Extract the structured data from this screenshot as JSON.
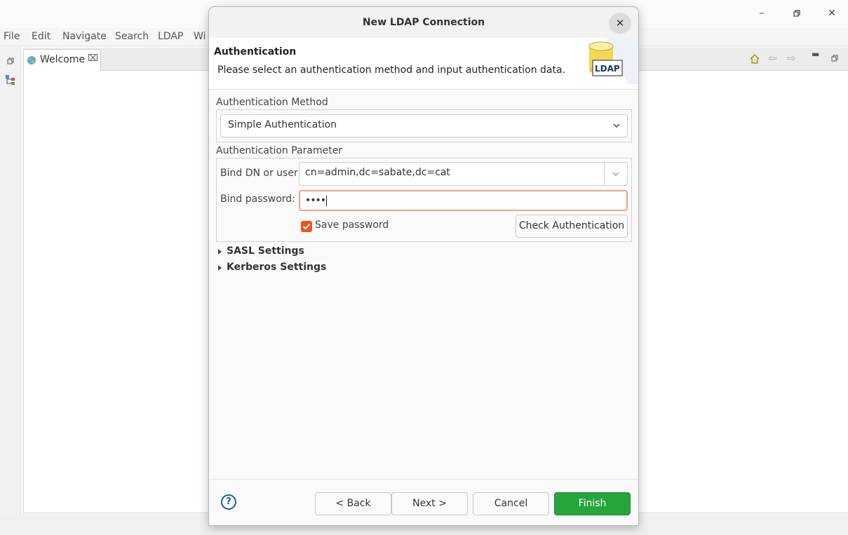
{
  "ide": {
    "menu": [
      "File",
      "Edit",
      "Navigate",
      "Search",
      "LDAP",
      "Wi"
    ],
    "tab_welcome": "Welcome",
    "window_controls": [
      "minimize-icon",
      "restore-icon",
      "close-icon"
    ]
  },
  "dialog": {
    "title": "New LDAP Connection",
    "banner": {
      "title": "Authentication",
      "description": "Please select an authentication method and input authentication data.",
      "image_label": "LDAP"
    },
    "auth_method": {
      "group_label": "Authentication Method",
      "selected": "Simple Authentication"
    },
    "auth_param": {
      "group_label": "Authentication Parameter",
      "bind_dn_label": "Bind DN or user:",
      "bind_dn_value": "cn=admin,dc=sabate,dc=cat",
      "bind_password_label": "Bind password:",
      "bind_password_value": "••••",
      "save_password_label": "Save password",
      "save_password_checked": true,
      "check_auth_label": "Check Authentication"
    },
    "sasl_label": "SASL Settings",
    "kerberos_label": "Kerberos Settings",
    "footer": {
      "help_glyph": "?",
      "back": "< Back",
      "next": "Next >",
      "cancel": "Cancel",
      "finish": "Finish"
    },
    "colors": {
      "accent": "#e95420",
      "finish": "#26a53b",
      "focus_border": "#e8a48c"
    }
  }
}
